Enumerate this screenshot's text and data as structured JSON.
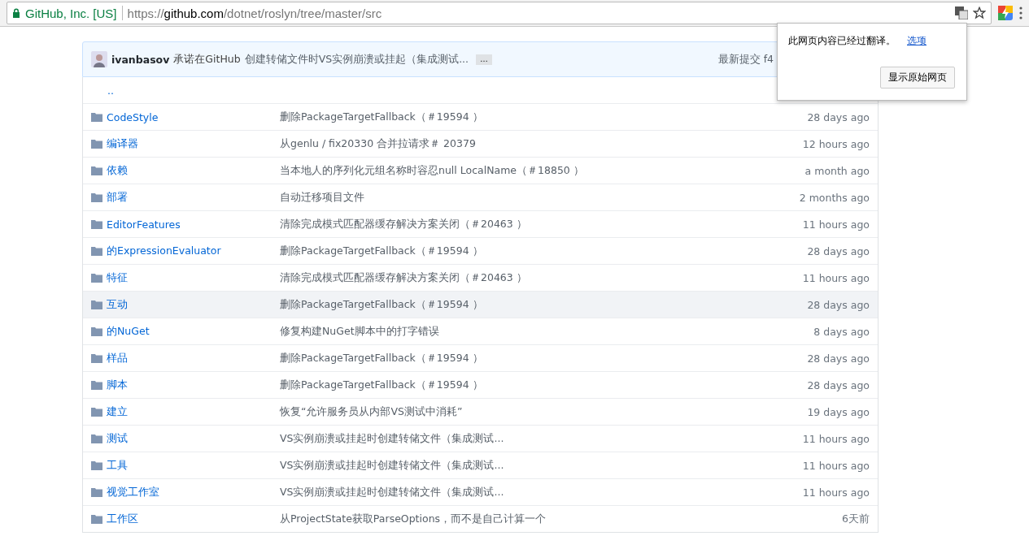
{
  "browser": {
    "site_identity": "GitHub, Inc. [US]",
    "url_scheme": "https://",
    "url_host": "github.com",
    "url_path": "/dotnet/roslyn/tree/master/src"
  },
  "commit_bar": {
    "author": "ivanbasov",
    "action": "承诺在GitHub",
    "message": "创建转储文件时VS实例崩溃或挂起（集成测试...",
    "expand_label": "…",
    "latest_label": "最新提交 f4"
  },
  "parent_link": "..",
  "files": [
    {
      "name": "CodeStyle",
      "message": "删除PackageTargetFallback（＃19594 ）",
      "age": "28 days ago",
      "hovered": false
    },
    {
      "name": "编译器",
      "message": "从genlu / fix20330 合并拉请求＃ 20379",
      "age": "12 hours ago",
      "hovered": false
    },
    {
      "name": "依赖",
      "message": "当本地人的序列化元组名称时容忍null LocalName（＃18850 ）",
      "age": "a month ago",
      "hovered": false
    },
    {
      "name": "部署",
      "message": "自动迁移项目文件",
      "age": "2 months ago",
      "hovered": false
    },
    {
      "name": "EditorFeatures",
      "message": "清除完成模式匹配器缓存解决方案关闭（＃20463 ）",
      "age": "11 hours ago",
      "hovered": false
    },
    {
      "name": "的ExpressionEvaluator",
      "message": "删除PackageTargetFallback（＃19594 ）",
      "age": "28 days ago",
      "hovered": false
    },
    {
      "name": "特征",
      "message": "清除完成模式匹配器缓存解决方案关闭（＃20463 ）",
      "age": "11 hours ago",
      "hovered": false
    },
    {
      "name": "互动",
      "message": "删除PackageTargetFallback（＃19594 ）",
      "age": "28 days ago",
      "hovered": true
    },
    {
      "name": "的NuGet",
      "message": "修复构建NuGet脚本中的打字错误",
      "age": "8 days ago",
      "hovered": false
    },
    {
      "name": "样品",
      "message": "删除PackageTargetFallback（＃19594 ）",
      "age": "28 days ago",
      "hovered": false
    },
    {
      "name": "脚本",
      "message": "删除PackageTargetFallback（＃19594 ）",
      "age": "28 days ago",
      "hovered": false
    },
    {
      "name": "建立",
      "message": "恢复“允许服务员从内部VS测试中消耗”",
      "age": "19 days ago",
      "hovered": false
    },
    {
      "name": "测试",
      "message": "VS实例崩溃或挂起时创建转储文件（集成测试...",
      "age": "11 hours ago",
      "hovered": false
    },
    {
      "name": "工具",
      "message": "VS实例崩溃或挂起时创建转储文件（集成测试...",
      "age": "11 hours ago",
      "hovered": false
    },
    {
      "name": "视觉工作室",
      "message": "VS实例崩溃或挂起时创建转储文件（集成测试...",
      "age": "11 hours ago",
      "hovered": false
    },
    {
      "name": "工作区",
      "message": "从ProjectState获取ParseOptions，而不是自己计算一个",
      "age": "6天前",
      "hovered": false
    }
  ],
  "translate_popup": {
    "message": "此网页内容已经过翻译。",
    "options_link": "选项",
    "button": "显示原始网页"
  }
}
